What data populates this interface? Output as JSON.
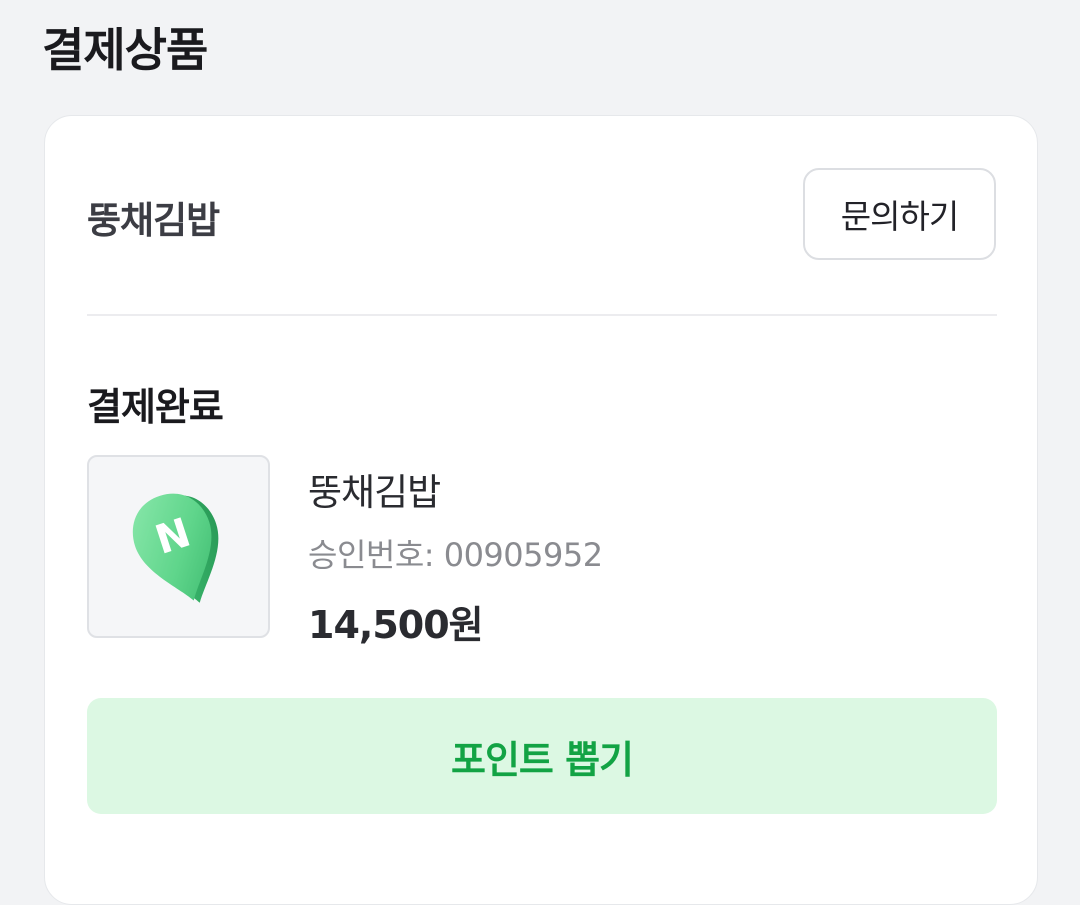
{
  "section": {
    "title": "결제상품"
  },
  "order": {
    "store_name": "뚱채김밥",
    "inquiry_label": "문의하기",
    "status": "결제완료",
    "thumbnail_icon": "naver-map-pin-icon",
    "thumbnail_letter": "N",
    "product_name": "뚱채김밥",
    "approval_text": "승인번호: 00905952",
    "price": "14,500원",
    "points_button_label": "포인트 뽑기"
  },
  "colors": {
    "page_background": "#f2f3f5",
    "card_background": "#ffffff",
    "accent_green": "#12a344",
    "accent_green_bg": "#dcf8e3",
    "pin_green": "#5fd58b",
    "muted_text": "#8a8b90"
  }
}
